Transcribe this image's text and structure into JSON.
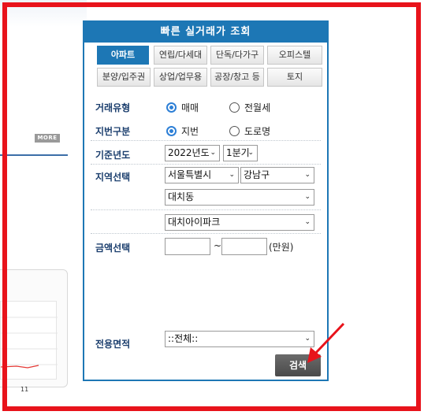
{
  "background": {
    "more_label": "MORE",
    "chart_label": "11"
  },
  "widget": {
    "title": "빠른 실거래가 조회",
    "tabs_row1": [
      "아파트",
      "연립/다세대",
      "단독/다가구",
      "오피스텔"
    ],
    "tabs_row2": [
      "분양/입주권",
      "상업/업무용",
      "공장/창고 등",
      "토지"
    ],
    "active_tab": "아파트",
    "deal_type": {
      "label": "거래유형",
      "options": [
        "매매",
        "전월세"
      ],
      "selected": "매매"
    },
    "address_type": {
      "label": "지번구분",
      "options": [
        "지번",
        "도로명"
      ],
      "selected": "지번"
    },
    "base_year": {
      "label": "기준년도",
      "year": "2022년도",
      "quarter": "1분기"
    },
    "region": {
      "label": "지역선택",
      "city": "서울특별시",
      "district": "강남구",
      "dong": "대치동",
      "complex": "대치아이파크"
    },
    "amount": {
      "label": "금액선택",
      "separator": "~",
      "unit": "(만원)",
      "min_value": "",
      "max_value": ""
    },
    "area": {
      "label": "전용면적",
      "value": "::전체::"
    },
    "search_button": "검색"
  },
  "colors": {
    "accent": "#1d77b5",
    "annotation": "#e8131b",
    "button": "#555555"
  }
}
